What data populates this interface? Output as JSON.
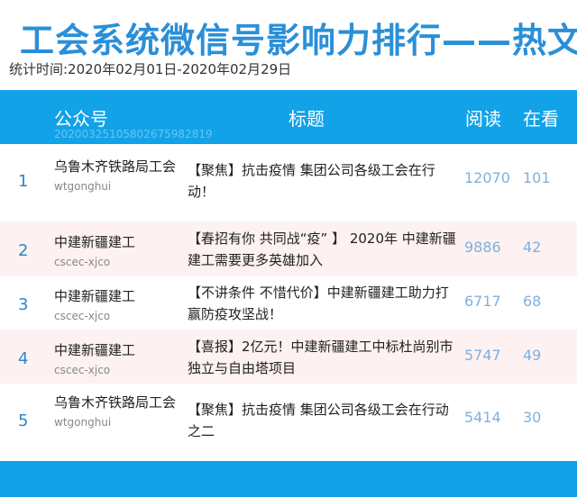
{
  "header": {
    "title": "工会系统微信号影响力排行——热文",
    "date_range": "统计时间:2020年02月01日-2020年02月29日"
  },
  "table": {
    "columns": {
      "account": "公众号",
      "title": "标题",
      "reads": "阅读",
      "looking": "在看"
    },
    "report_id": "20200325105802675982819",
    "rows": [
      {
        "rank": "1",
        "account": "乌鲁木齐铁路局工会",
        "account_id": "wtgonghui",
        "title": "【聚焦】抗击疫情 集团公司各级工会在行动！",
        "reads": "12070",
        "looking": "101"
      },
      {
        "rank": "2",
        "account": "中建新疆建工",
        "account_id": "cscec-xjco",
        "title": "【春招有你  共同战“疫”  】 2020年 中建新疆建工需要更多英雄加入",
        "reads": "9886",
        "looking": "42"
      },
      {
        "rank": "3",
        "account": "中建新疆建工",
        "account_id": "cscec-xjco",
        "title": "【不讲条件  不惜代价】中建新疆建工助力打赢防疫攻坚战！",
        "reads": "6717",
        "looking": "68"
      },
      {
        "rank": "4",
        "account": "中建新疆建工",
        "account_id": "cscec-xjco",
        "title": "【喜报】2亿元！中建新疆建工中标杜尚别市独立与自由塔项目",
        "reads": "5747",
        "looking": "49"
      },
      {
        "rank": "5",
        "account": "乌鲁木齐铁路局工会",
        "account_id": "wtgonghui",
        "title": "【聚焦】抗击疫情  集团公司各级工会在行动之二",
        "reads": "5414",
        "looking": "30"
      }
    ]
  },
  "colors": {
    "title": "#2a8fd8",
    "header_bg": "#11a2e8",
    "alt_row_bg": "#fdf1f1",
    "rank": "#2e86c8",
    "metric": "#7fb0de"
  }
}
